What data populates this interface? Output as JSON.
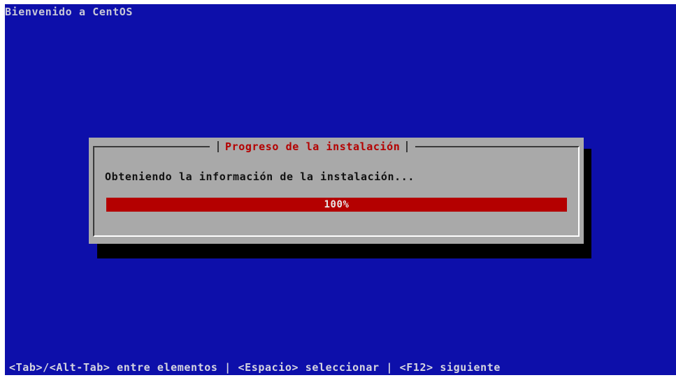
{
  "window": {
    "title": "Bienvenido a CentOS"
  },
  "dialog": {
    "title": "Progreso de la instalación",
    "message": "Obteniendo la información de la instalación...",
    "progress": {
      "value_percent": 100,
      "label": "100%"
    }
  },
  "status_bar": {
    "help_text": "<Tab>/<Alt-Tab> entre elementos | <Espacio> seleccionar | <F12> siguiente"
  },
  "colors": {
    "background": "#0d0faa",
    "dialog": "#a9a9a9",
    "accent": "#b40000",
    "shadow": "#000000"
  }
}
